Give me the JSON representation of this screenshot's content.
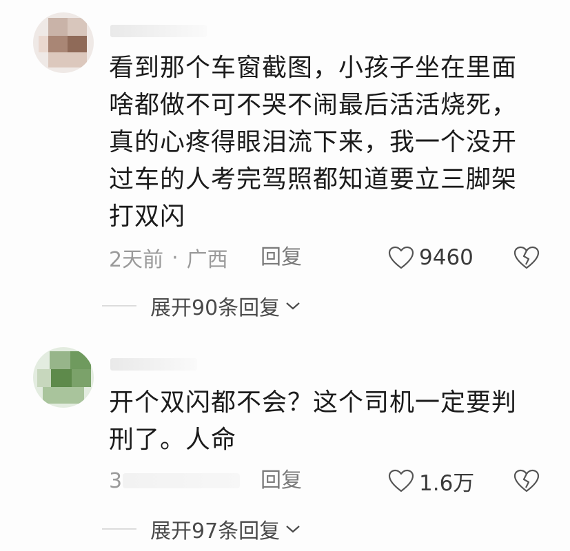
{
  "comments": [
    {
      "text_lines": [
        "看到那个车窗截图，小孩子坐在里面",
        "啥都做不可不哭不闹最后活活烧死，",
        "真的心疼得眼泪流下来，我一个没开",
        "过车的人考完驾照都知道要立三脚架",
        "打双闪"
      ],
      "time": "2天前",
      "location": "广西",
      "reply_label": "回复",
      "likes": "9460",
      "expand_label": "展开90条回复"
    },
    {
      "text_lines": [
        "开个双闪都不会？这个司机一定要判",
        "刑了。人命"
      ],
      "time": "3",
      "reply_label": "回复",
      "likes": "1.6万",
      "expand_label": "展开97条回复"
    }
  ],
  "colors": {
    "text": "#1b1b1b",
    "meta": "#9a9a9a",
    "icon": "#555555"
  },
  "icons": [
    "heart-icon",
    "broken-heart-icon",
    "chevron-down-icon"
  ]
}
